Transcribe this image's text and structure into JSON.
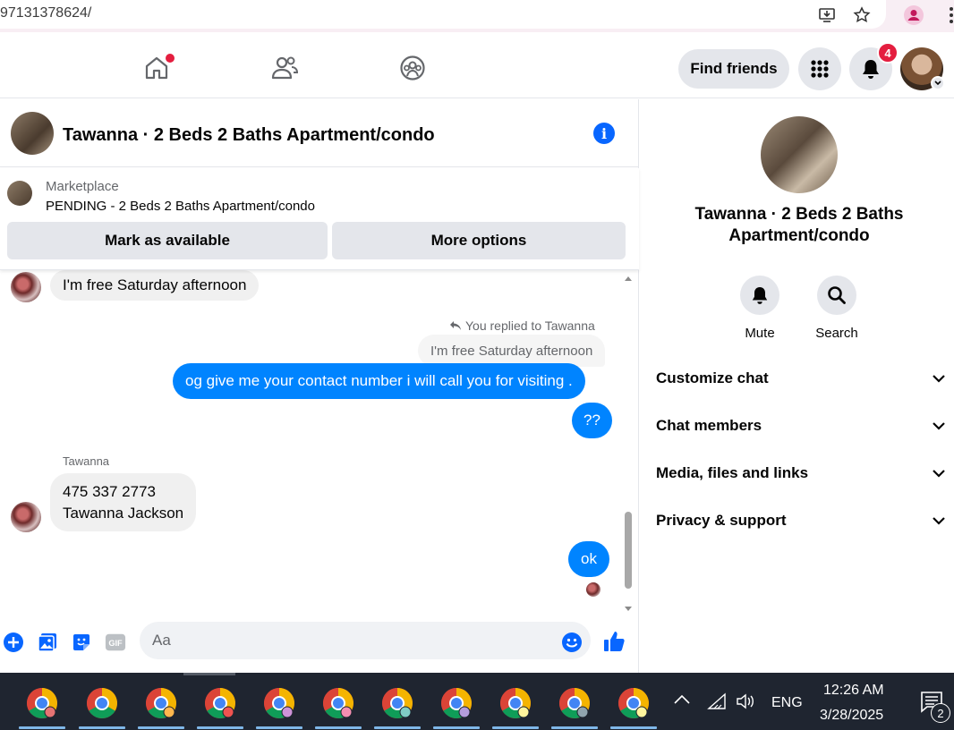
{
  "browser": {
    "url": "97131378624/"
  },
  "header": {
    "find_friends_label": "Find friends",
    "notification_count": "4"
  },
  "chat": {
    "title": "Tawanna · 2 Beds 2 Baths Apartment/condo",
    "marketplace_label": "Marketplace",
    "listing_status": "PENDING - 2 Beds 2 Baths Apartment/condo",
    "mark_available_label": "Mark as available",
    "more_options_label": "More options",
    "messages": {
      "msg1": "I'm free Saturday afternoon",
      "reply_note": "You replied to Tawanna",
      "quoted": "I'm free Saturday afternoon",
      "msg2": "og give me your contact number i will call you for visiting .",
      "msg3": "??",
      "sender_name": "Tawanna",
      "msg4_line1": "475 337 2773",
      "msg4_line2": "Tawanna Jackson",
      "msg5": "ok"
    },
    "composer_placeholder": "Aa"
  },
  "right_panel": {
    "title": "Tawanna · 2 Beds 2 Baths Apartment/condo",
    "mute_label": "Mute",
    "search_label": "Search",
    "sections": [
      "Customize chat",
      "Chat members",
      "Media, files and links",
      "Privacy & support"
    ]
  },
  "taskbar": {
    "language": "ENG",
    "time": "12:26 AM",
    "date": "3/28/2025",
    "notification_count": "2"
  },
  "colors": {
    "messenger_blue": "#0084ff",
    "fb_blue": "#0866ff",
    "badge_red": "#e41e3f"
  }
}
